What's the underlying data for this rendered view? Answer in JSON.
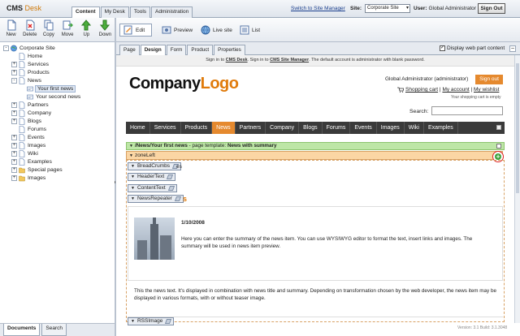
{
  "app": {
    "logo_cms": "CMS",
    "logo_desk": "Desk"
  },
  "top_tabs": [
    "Content",
    "My Desk",
    "Tools",
    "Administration"
  ],
  "header": {
    "switch_link": "Switch to Site Manager",
    "site_label": "Site:",
    "site_value": "Corporate Site",
    "user_label": "User:",
    "user_value": "Global Administrator",
    "sign_out": "Sign Out"
  },
  "left_toolbar": [
    "New",
    "Delete",
    "Copy",
    "Move",
    "Up",
    "Down"
  ],
  "right_toolbar": {
    "edit": "Edit",
    "preview": "Preview",
    "live_site": "Live site",
    "list": "List"
  },
  "tree": [
    {
      "label": "Corporate Site",
      "level": 0,
      "pm": "-"
    },
    {
      "label": "Home",
      "level": 1,
      "pm": ""
    },
    {
      "label": "Services",
      "level": 1,
      "pm": "+"
    },
    {
      "label": "Products",
      "level": 1,
      "pm": "+"
    },
    {
      "label": "News",
      "level": 1,
      "pm": "-"
    },
    {
      "label": "Your first news",
      "level": 2,
      "pm": "",
      "selected": true
    },
    {
      "label": "Your second news",
      "level": 2,
      "pm": ""
    },
    {
      "label": "Partners",
      "level": 1,
      "pm": "+"
    },
    {
      "label": "Company",
      "level": 1,
      "pm": "+"
    },
    {
      "label": "Blogs",
      "level": 1,
      "pm": "+"
    },
    {
      "label": "Forums",
      "level": 1,
      "pm": ""
    },
    {
      "label": "Events",
      "level": 1,
      "pm": "+"
    },
    {
      "label": "Images",
      "level": 1,
      "pm": "+"
    },
    {
      "label": "Wiki",
      "level": 1,
      "pm": "+"
    },
    {
      "label": "Examples",
      "level": 1,
      "pm": "+"
    },
    {
      "label": "Special pages",
      "level": 1,
      "pm": "+"
    },
    {
      "label": "Images",
      "level": 1,
      "pm": "+"
    }
  ],
  "bottom_tabs": [
    "Documents",
    "Search"
  ],
  "content_tabs": [
    "Page",
    "Design",
    "Form",
    "Product",
    "Properties"
  ],
  "display_webpart_label": "Display web part content",
  "signbar": {
    "p1": "Sign in to ",
    "cms_desk": "CMS Desk",
    "p2": ". Sign in to ",
    "site_manager": "CMS Site Manager",
    "p3": ". The default account is administrator with blank password."
  },
  "site": {
    "logo_company": "Company",
    "logo_logo": "Logo",
    "admin_text": "Global Administrator (administrator)",
    "sign_out": "Sign out",
    "shopping_cart": "Shopping cart",
    "my_account": "My account",
    "my_wishlist": "My wishlist",
    "cart_empty": "Your shopping cart is empty",
    "search_label": "Search:",
    "nav": [
      "Home",
      "Services",
      "Products",
      "News",
      "Partners",
      "Company",
      "Blogs",
      "Forums",
      "Events",
      "Images",
      "Wiki",
      "Examples"
    ]
  },
  "design": {
    "template_path": "/News/Your first news",
    "template_mid": " - page template: ",
    "template_name": "News with summary",
    "zone": "zoneLeft",
    "webparts": [
      "BreadCrumbs",
      "HeaderText",
      "ContentText",
      "NewsRepeater",
      "RSSImage"
    ],
    "trail_es": "es",
    "trail_s": "s"
  },
  "news": {
    "date": "1/10/2008",
    "summary": "Here you can enter the summary of the news item. You can use WYSIWYG editor to format the text, insert links and images. The summary will be used in news item preview.",
    "text": "This the news text. It's displayed in combination with news title and summary. Depending on transformation chosen by the web developer, the news item may be displayed in various formats, with or without teaser image."
  },
  "version": "Version: 3.1 Build: 3.1.3048",
  "colors": {
    "accent": "#e5892e",
    "nav_bg": "#3a3a3a",
    "zone": "#fbd6a4",
    "template": "#bde6a6"
  }
}
